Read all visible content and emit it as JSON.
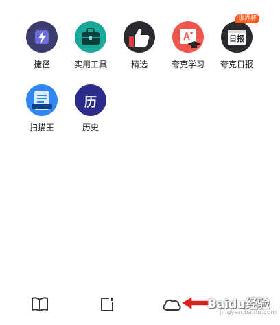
{
  "apps": [
    {
      "label": "捷径",
      "icon": "shortcut-icon"
    },
    {
      "label": "实用工具",
      "icon": "toolbox-icon"
    },
    {
      "label": "精选",
      "icon": "thumbs-up-icon"
    },
    {
      "label": "夸克学习",
      "icon": "study-icon"
    },
    {
      "label": "夸克日报",
      "icon": "daily-news-icon",
      "badge": "世界杯",
      "icon_text": "日报"
    },
    {
      "label": "扫描王",
      "icon": "scanner-icon"
    },
    {
      "label": "历史",
      "icon": "history-icon",
      "icon_text": "历"
    }
  ],
  "bottom_bar": {
    "tabs": [
      {
        "icon": "book-icon"
      },
      {
        "icon": "tabs-icon"
      },
      {
        "icon": "cloud-icon"
      }
    ]
  },
  "watermark": {
    "text": "Baidu经验",
    "sub": "jingyan.baidu.com"
  },
  "colors": {
    "accent_orange": "#ff5a1f",
    "shortcut_purple": "#3c3c6e",
    "toolbox_teal": "#1aa89a",
    "scanner_blue": "#2f86f0",
    "history_navy": "#2c2c8a"
  }
}
